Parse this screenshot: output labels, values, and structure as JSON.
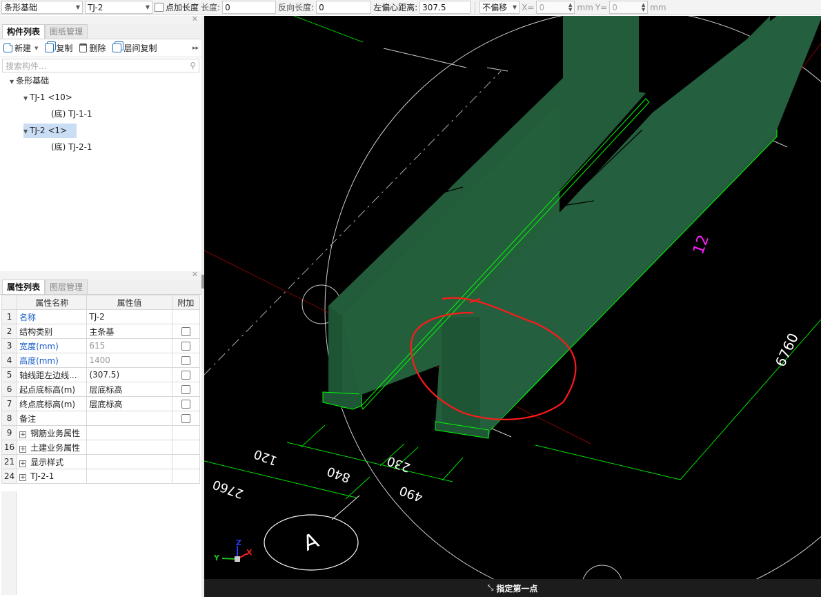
{
  "toolbar": {
    "type_select": "条形基础",
    "component_select": "TJ-2",
    "point_length_label": "点加长度",
    "length_label": "长度:",
    "length_value": "0",
    "reverse_length_label": "反向长度:",
    "reverse_length_value": "0",
    "left_offset_label": "左偏心距离:",
    "left_offset_value": "307.5",
    "offset_select": "不偏移",
    "x_label": "X=",
    "x_value": "0",
    "mm1": "mm",
    "y_label": "Y=",
    "y_value": "0",
    "mm2": "mm"
  },
  "component_panel": {
    "tabs": [
      "构件列表",
      "图纸管理"
    ],
    "actions": {
      "new": "新建",
      "copy": "复制",
      "delete": "删除",
      "floor_copy": "层间复制"
    },
    "search_placeholder": "搜索构件...",
    "tree": [
      {
        "label": "条形基础"
      },
      {
        "label": "TJ-1 <10>"
      },
      {
        "label": "(底) TJ-1-1"
      },
      {
        "label": "TJ-2 <1>"
      },
      {
        "label": "(底) TJ-2-1"
      }
    ]
  },
  "property_panel": {
    "tabs": [
      "属性列表",
      "图层管理"
    ],
    "headers": [
      "属性名称",
      "属性值",
      "附加"
    ],
    "rows": [
      {
        "num": "1",
        "name": "名称",
        "value": "TJ-2"
      },
      {
        "num": "2",
        "name": "结构类别",
        "value": "主条基"
      },
      {
        "num": "3",
        "name": "宽度(mm)",
        "value": "615"
      },
      {
        "num": "4",
        "name": "高度(mm)",
        "value": "1400"
      },
      {
        "num": "5",
        "name": "轴线距左边线...",
        "value": "(307.5)"
      },
      {
        "num": "6",
        "name": "起点底标高(m)",
        "value": "层底标高"
      },
      {
        "num": "7",
        "name": "终点底标高(m)",
        "value": "层底标高"
      },
      {
        "num": "8",
        "name": "备注",
        "value": ""
      },
      {
        "num": "9",
        "name": "钢筋业务属性",
        "value": ""
      },
      {
        "num": "16",
        "name": "土建业务属性",
        "value": ""
      },
      {
        "num": "21",
        "name": "显示样式",
        "value": ""
      },
      {
        "num": "24",
        "name": "TJ-2-1",
        "value": ""
      }
    ]
  },
  "viewport": {
    "dimensions": [
      "120",
      "840",
      "230",
      "490",
      "2760",
      "6760",
      "12"
    ],
    "axis_bubble": "A",
    "axes": {
      "x": "X",
      "y": "Y",
      "z": "Z"
    },
    "status": "指定第一点",
    "colors": {
      "beam": "#225c3a",
      "beam_side": "#1a4a2e",
      "dim": "#00ff00",
      "grid": "#d0d0d0",
      "axis_red": "#8a0000",
      "annotation": "#ff2020",
      "label12": "#ff20ff"
    }
  }
}
